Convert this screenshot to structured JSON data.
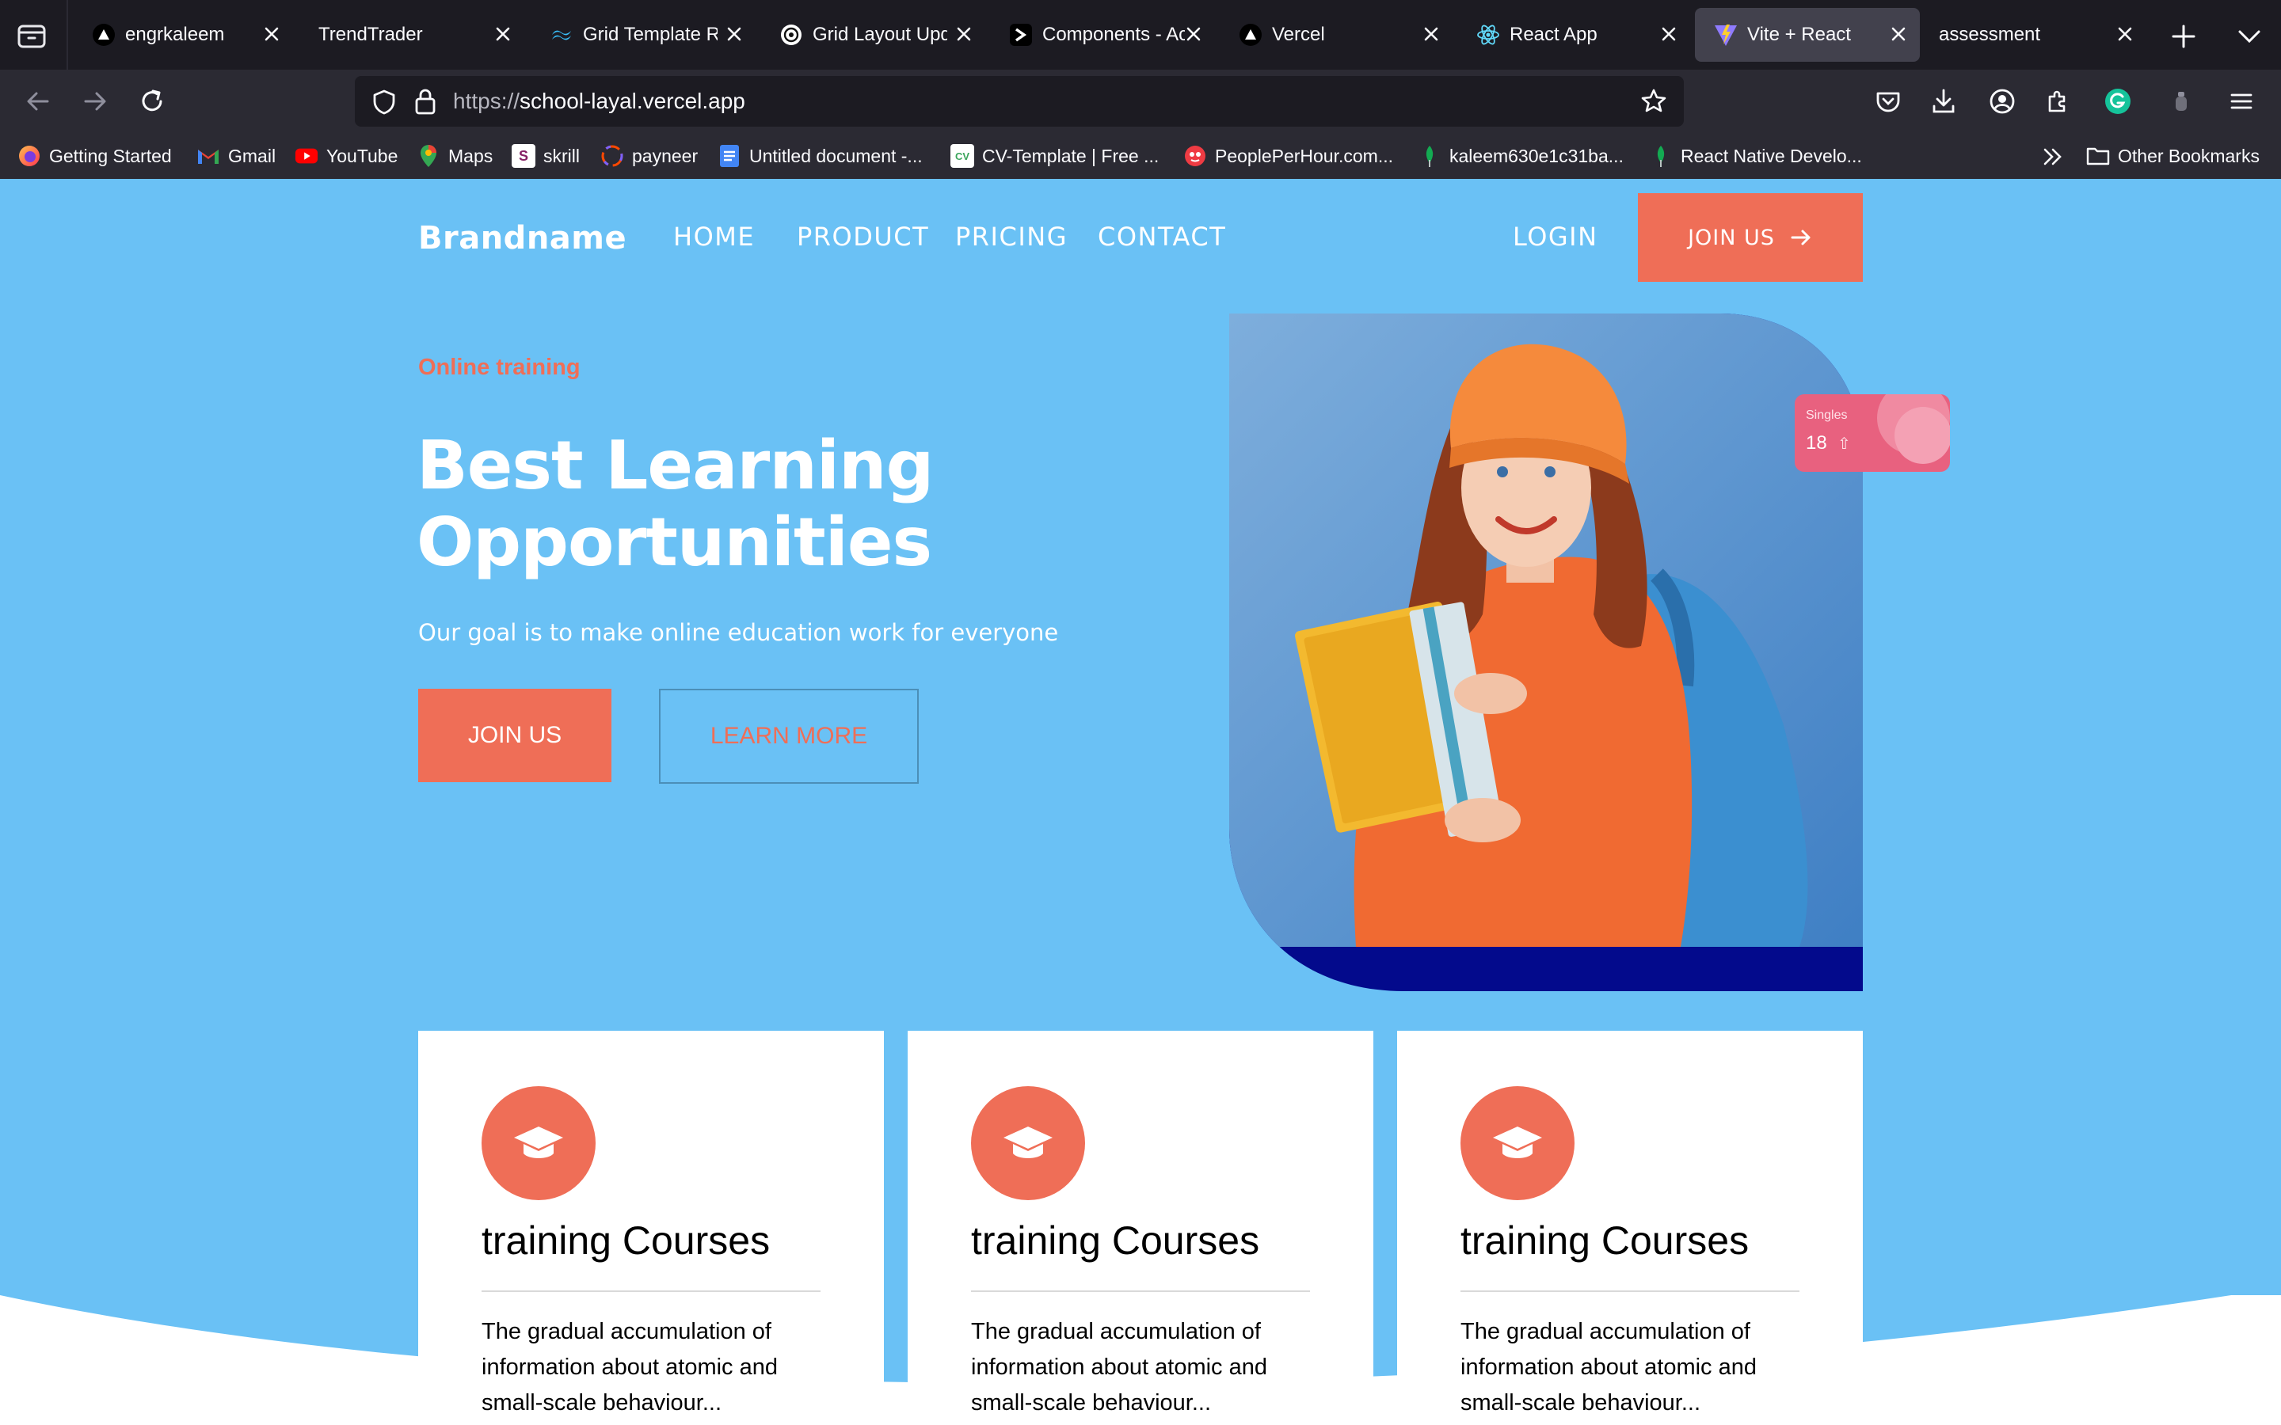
{
  "browser": {
    "tabs": [
      {
        "label": "engrkaleem",
        "favicon": "vercel-triangle-icon",
        "active": false
      },
      {
        "label": "TrendTrader",
        "favicon": "none",
        "active": false
      },
      {
        "label": "Grid Template Ro",
        "favicon": "tailwind-icon",
        "active": false
      },
      {
        "label": "Grid Layout Upda",
        "favicon": "openai-icon",
        "active": false
      },
      {
        "label": "Components - Ac",
        "favicon": "terminal-prompt-icon",
        "active": false
      },
      {
        "label": "Vercel",
        "favicon": "vercel-triangle-icon",
        "active": false
      },
      {
        "label": "React App",
        "favicon": "react-icon",
        "active": false
      },
      {
        "label": "Vite + React",
        "favicon": "vite-icon",
        "active": true
      },
      {
        "label": "assessment",
        "favicon": "none",
        "active": false
      }
    ],
    "url_scheme": "https://",
    "url_host": "school-layal.vercel.app",
    "bookmarks": [
      {
        "label": "Getting Started",
        "icon": "firefox-icon"
      },
      {
        "label": "Gmail",
        "icon": "gmail-icon"
      },
      {
        "label": "YouTube",
        "icon": "youtube-icon"
      },
      {
        "label": "Maps",
        "icon": "maps-pin-icon"
      },
      {
        "label": "skrill",
        "icon": "skrill-icon"
      },
      {
        "label": "payneer",
        "icon": "payoneer-icon"
      },
      {
        "label": "Untitled document -...",
        "icon": "google-docs-icon"
      },
      {
        "label": "CV-Template | Free ...",
        "icon": "cv-icon"
      },
      {
        "label": "PeoplePerHour.com...",
        "icon": "peopleperhour-icon"
      },
      {
        "label": "kaleem630e1c31ba...",
        "icon": "mongodb-leaf-icon"
      },
      {
        "label": "React Native Develo...",
        "icon": "mongodb-leaf-icon"
      }
    ],
    "other_bookmarks": "Other Bookmarks"
  },
  "site": {
    "brand": "Brandname",
    "nav": [
      "HOME",
      "PRODUCT",
      "PRICING",
      "CONTACT"
    ],
    "login": "LOGIN",
    "join_top": "JOIN US",
    "hero": {
      "eyebrow": "Online training",
      "title_line1": "Best Learning",
      "title_line2": "Opportunities",
      "subtitle": "Our goal is to make online education work for everyone",
      "join_button": "JOIN US",
      "learn_button": "LEARN MORE"
    },
    "badge": {
      "label": "Singles",
      "value": "18"
    },
    "cards": [
      {
        "title": "training Courses",
        "text": "The gradual accumulation of information about atomic and small-scale behaviour..."
      },
      {
        "title": "training Courses",
        "text": "The gradual accumulation of information about atomic and small-scale behaviour..."
      },
      {
        "title": "training Courses",
        "text": "The gradual accumulation of information about atomic and small-scale behaviour..."
      }
    ]
  },
  "colors": {
    "page_bg": "#6ac1f5",
    "accent": "#ef6e57",
    "dark_blue": "#030a8c",
    "chrome_dark": "#1c1b22",
    "chrome_mid": "#2b2a33",
    "active_tab": "#42414d"
  }
}
